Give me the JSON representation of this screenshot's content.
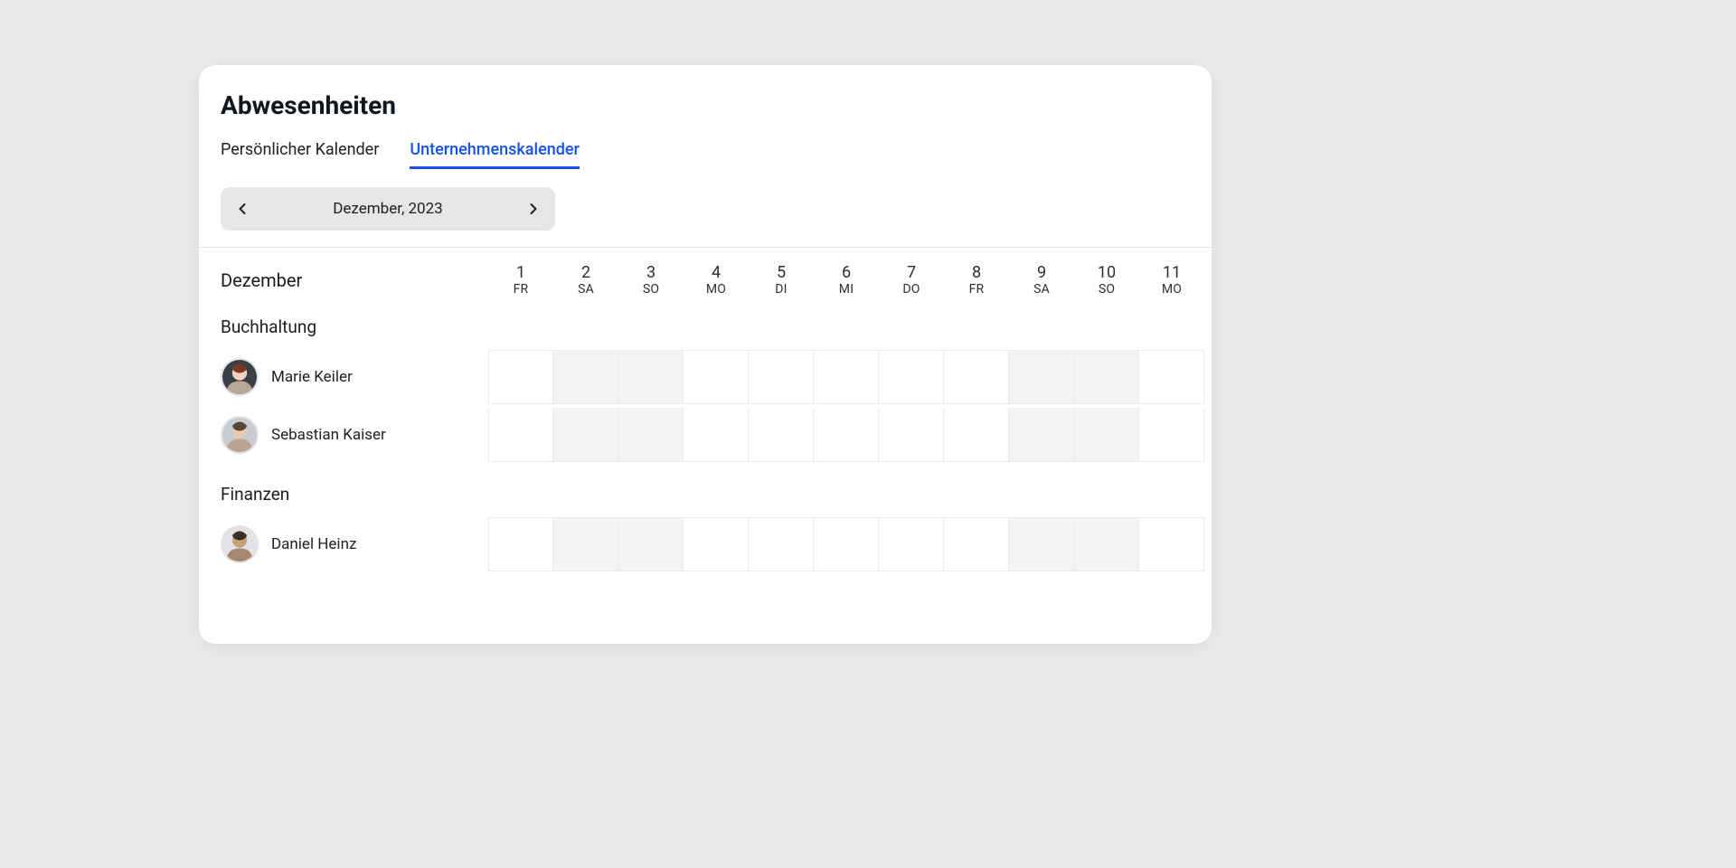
{
  "page_title": "Abwesenheiten",
  "tabs": [
    {
      "label": "Persönlicher Kalender",
      "active": false
    },
    {
      "label": "Unternehmenskalender",
      "active": true
    }
  ],
  "month_picker": {
    "label": "Dezember, 2023"
  },
  "calendar": {
    "month_label": "Dezember",
    "days": [
      {
        "num": "1",
        "wd": "FR",
        "weekend": false
      },
      {
        "num": "2",
        "wd": "SA",
        "weekend": true
      },
      {
        "num": "3",
        "wd": "SO",
        "weekend": true
      },
      {
        "num": "4",
        "wd": "MO",
        "weekend": false
      },
      {
        "num": "5",
        "wd": "DI",
        "weekend": false
      },
      {
        "num": "6",
        "wd": "MI",
        "weekend": false
      },
      {
        "num": "7",
        "wd": "DO",
        "weekend": false
      },
      {
        "num": "8",
        "wd": "FR",
        "weekend": false
      },
      {
        "num": "9",
        "wd": "SA",
        "weekend": true
      },
      {
        "num": "10",
        "wd": "SO",
        "weekend": true
      },
      {
        "num": "11",
        "wd": "MO",
        "weekend": false
      }
    ],
    "groups": [
      {
        "name": "Buchhaltung",
        "people": [
          {
            "name": "Marie Keiler",
            "avatar": "person-f1"
          },
          {
            "name": "Sebastian Kaiser",
            "avatar": "person-m1"
          }
        ]
      },
      {
        "name": "Finanzen",
        "people": [
          {
            "name": "Daniel Heinz",
            "avatar": "person-m2"
          }
        ]
      }
    ]
  }
}
